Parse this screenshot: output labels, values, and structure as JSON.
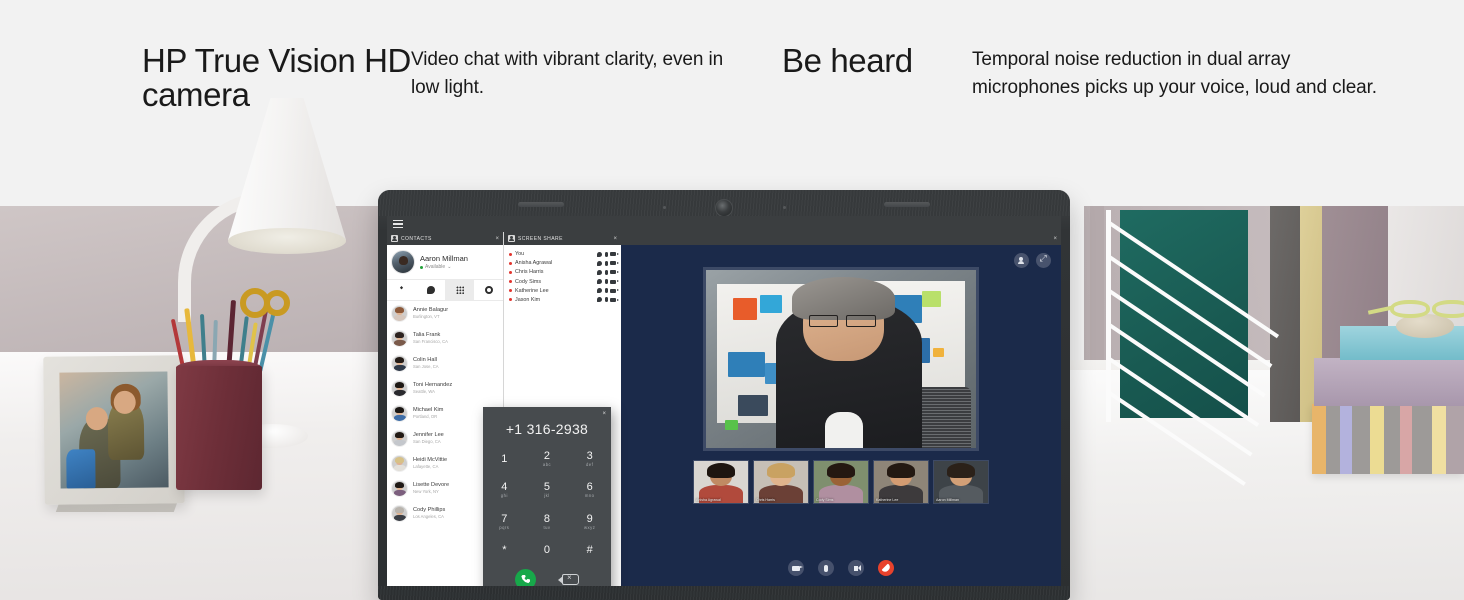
{
  "banner": {
    "headline_1": "HP True Vision\nHD camera",
    "body_1": "Video chat with vibrant clarity, even in low light.",
    "headline_2": "Be heard",
    "body_2": "Temporal noise reduction in dual array microphones picks up your voice, loud and clear."
  },
  "app": {
    "menu_icon": "hamburger-icon",
    "tabs": [
      {
        "label": "CONTACTS",
        "icon": "contact-card-icon",
        "close": "×"
      },
      {
        "label": "SCREEN SHARE",
        "icon": "person-icon",
        "close": "×"
      }
    ],
    "video_tab_close": "×",
    "me": {
      "name": "Aaron Millman",
      "status": "Available",
      "status_caret": "⌄",
      "status_color": "#23a23a"
    },
    "tool_tabs": [
      {
        "name": "contacts",
        "icon": "person-icon",
        "active": false
      },
      {
        "name": "chat",
        "icon": "chat-bubble-icon",
        "active": false
      },
      {
        "name": "dialpad",
        "icon": "grid-dialpad-icon",
        "active": true
      },
      {
        "name": "settings",
        "icon": "gear-icon",
        "active": false
      }
    ],
    "contacts": [
      {
        "name": "Annie Balagur",
        "location": "Burlington, VT",
        "hair": "#8d5a3a",
        "top": "#d6c7bd"
      },
      {
        "name": "Talia Frank",
        "location": "San Francisco, CA",
        "hair": "#2d2320",
        "top": "#7a5a4a"
      },
      {
        "name": "Colin Hall",
        "location": "San Jose, CA",
        "hair": "#241c17",
        "top": "#2f3a49"
      },
      {
        "name": "Toni Hernandez",
        "location": "Seattle, WA",
        "hair": "#1d1814",
        "top": "#2a2a2e"
      },
      {
        "name": "Michael Kim",
        "location": "Portland, OR",
        "hair": "#1b1714",
        "top": "#3f6ea8"
      },
      {
        "name": "Jennifer Lee",
        "location": "San Diego, CA",
        "hair": "#221a14",
        "top": "#c4c7cc"
      },
      {
        "name": "Heidi McVittie",
        "location": "Lafayette, CA",
        "hair": "#d7c187",
        "top": "#e3e0da"
      },
      {
        "name": "Lisette Devore",
        "location": "New York, NY",
        "hair": "#1f1a16",
        "top": "#7c5f7e"
      },
      {
        "name": "Cody Phillips",
        "location": "Los Angeles, CA",
        "hair": "#b9b4ad",
        "top": "#3b3f46"
      }
    ],
    "share_participants": [
      {
        "name": "You"
      },
      {
        "name": "Anisha Agrawal"
      },
      {
        "name": "Chris Harris"
      },
      {
        "name": "Cody Sims"
      },
      {
        "name": "Katherine Lee"
      },
      {
        "name": "Jason Kim"
      }
    ],
    "share_row_icons": [
      "chat-icon",
      "microphone-icon",
      "camera-icon"
    ],
    "stage_actions": [
      {
        "name": "add-participant",
        "icon": "add-person-icon"
      },
      {
        "name": "expand",
        "icon": "expand-icon"
      }
    ],
    "thumbnails": [
      {
        "label": "Anisha Agrawal",
        "face": "#c08a63",
        "hair": "#1d1510",
        "top": "#b14a3c",
        "bg": "#d9d6d1"
      },
      {
        "label": "Chris Harris",
        "face": "#e0b48d",
        "hair": "#c9a262",
        "top": "#6b4036",
        "bg": "#c6bfb6"
      },
      {
        "label": "Cody Sims",
        "face": "#9a6236",
        "hair": "#241811",
        "top": "#b08fa0",
        "bg": "#7f8f6e"
      },
      {
        "label": "Katherine Lee",
        "face": "#d49c72",
        "hair": "#241912",
        "top": "#3d3a3c",
        "bg": "#8e8578"
      },
      {
        "label": "Aaron Millman",
        "face": "#d3a077",
        "hair": "#2b2119",
        "top": "#555b60",
        "bg": "#3d4348"
      }
    ],
    "call_controls": [
      {
        "name": "toggle-camera",
        "icon": "camera-icon"
      },
      {
        "name": "toggle-mic",
        "icon": "microphone-icon"
      },
      {
        "name": "toggle-speaker",
        "icon": "speaker-icon"
      },
      {
        "name": "end-call",
        "icon": "hangup-icon"
      }
    ],
    "dialpad": {
      "close": "×",
      "number": "+1 316-2938",
      "keys": [
        {
          "digit": "1",
          "sub": ""
        },
        {
          "digit": "2",
          "sub": "abc"
        },
        {
          "digit": "3",
          "sub": "def"
        },
        {
          "digit": "4",
          "sub": "ghi"
        },
        {
          "digit": "5",
          "sub": "jkl"
        },
        {
          "digit": "6",
          "sub": "mno"
        },
        {
          "digit": "7",
          "sub": "pqrs"
        },
        {
          "digit": "8",
          "sub": "tuv"
        },
        {
          "digit": "9",
          "sub": "wxyz"
        },
        {
          "digit": "*",
          "sub": ""
        },
        {
          "digit": "0",
          "sub": ""
        },
        {
          "digit": "#",
          "sub": ""
        }
      ],
      "call_button": "call-icon",
      "backspace_button": "backspace-icon"
    }
  },
  "colors": {
    "accent_green": "#17a84a",
    "accent_red": "#e8422c",
    "video_bg": "#1b2a4a",
    "chrome": "#3b3e40"
  }
}
